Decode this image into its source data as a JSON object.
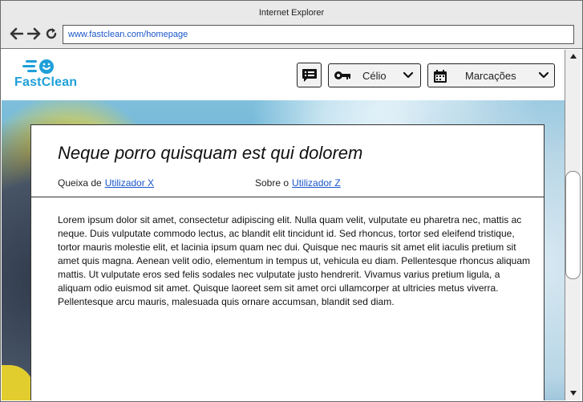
{
  "browser": {
    "title": "Internet Explorer",
    "url": "www.fastclean.com/homepage",
    "back_icon": "arrow-left-icon",
    "forward_icon": "arrow-right-icon",
    "refresh_icon": "refresh-icon"
  },
  "header": {
    "logo_text": "FastClean",
    "brand_color": "#1f9fd8",
    "complaints_icon": "list-icon",
    "user_menu": {
      "icon": "key-icon",
      "label": "Célio"
    },
    "appointments_menu": {
      "icon": "calendar-icon",
      "label": "Marcações"
    }
  },
  "complaint": {
    "title": "Neque porro quisquam est qui dolorem",
    "from_label": "Queixa de",
    "from_user": "Utilizador X",
    "about_label": "Sobre o",
    "about_user": "Utilizador Z",
    "body": "Lorem ipsum dolor sit amet, consectetur adipiscing elit. Nulla quam velit, vulputate eu pharetra nec, mattis ac neque. Duis vulputate commodo lectus, ac blandit elit tincidunt id. Sed rhoncus, tortor sed eleifend tristique, tortor mauris molestie elit, et lacinia ipsum quam nec dui. Quisque nec mauris sit amet elit iaculis pretium sit amet quis magna. Aenean velit odio, elementum in tempus ut, vehicula eu diam. Pellentesque rhoncus aliquam mattis. Ut vulputate eros sed felis sodales nec vulputate justo hendrerit. Vivamus varius pretium ligula, a aliquam odio euismod sit amet. Quisque laoreet sem sit amet orci ullamcorper at ultricies metus viverra. Pellentesque arcu mauris, malesuada quis ornare accumsan, blandit sed diam."
  }
}
